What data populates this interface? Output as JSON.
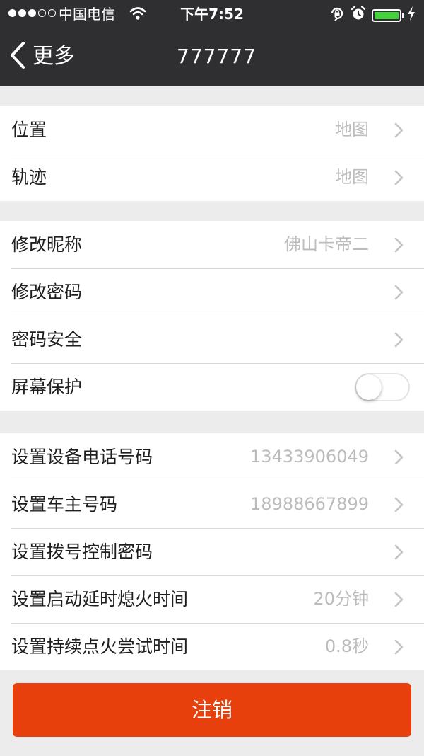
{
  "status_bar": {
    "signal_filled": 3,
    "signal_empty": 2,
    "carrier": "中国电信",
    "time": "下午7:52",
    "battery_level": 1.0,
    "battery_color": "#45d23c"
  },
  "nav": {
    "back_label": "更多",
    "title": "777777",
    "background": "#2f2f32"
  },
  "groups": {
    "location": [
      {
        "label": "位置",
        "value": "地图"
      },
      {
        "label": "轨迹",
        "value": "地图"
      }
    ],
    "account": {
      "nickname": {
        "label": "修改昵称",
        "value": "佛山卡帝二"
      },
      "password": {
        "label": "修改密码"
      },
      "password_security": {
        "label": "密码安全"
      },
      "screen_saver": {
        "label": "屏幕保护",
        "enabled": false
      }
    },
    "device": [
      {
        "label": "设置设备电话号码",
        "value": "13433906049"
      },
      {
        "label": "设置车主号码",
        "value": "18988667899"
      },
      {
        "label": "设置拨号控制密码",
        "value": ""
      },
      {
        "label": "设置启动延时熄火时间",
        "value": "20分钟"
      },
      {
        "label": "设置持续点火尝试时间",
        "value": "0.8秒"
      }
    ]
  },
  "logout": {
    "label": "注销",
    "color": "#e8400d"
  }
}
